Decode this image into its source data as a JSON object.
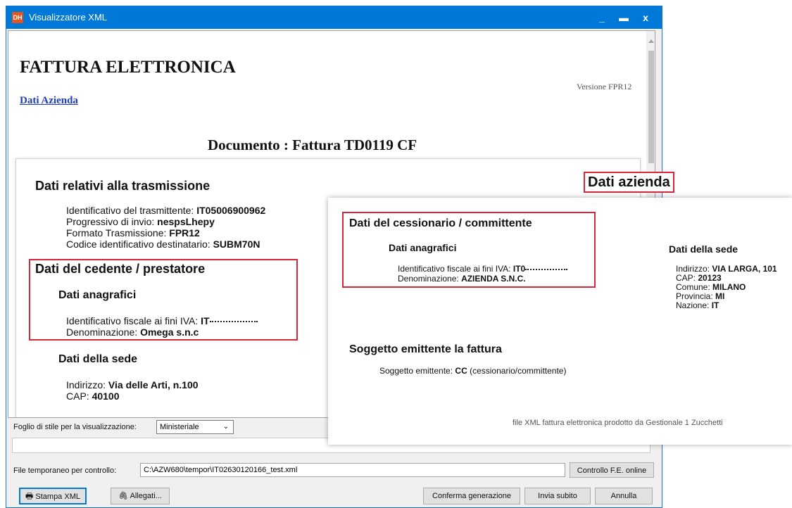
{
  "window": {
    "icon_text": "DH",
    "title": "Visualizzatore XML",
    "controls": [
      "_",
      "▬",
      "x"
    ]
  },
  "invoice": {
    "heading": "FATTURA ELETTRONICA",
    "company_link": "Dati Azienda",
    "version": "Versione FPR12",
    "document_title": "Documento : Fattura TD0119 CF",
    "trasmissione": {
      "title": "Dati relativi alla trasmissione",
      "rows": [
        {
          "label": "Identificativo del trasmittente: ",
          "value": "IT05006900962"
        },
        {
          "label": "Progressivo di invio: ",
          "value": "nespsLhepy"
        },
        {
          "label": "Formato Trasmissione: ",
          "value": "FPR12"
        },
        {
          "label": "Codice identificativo destinatario: ",
          "value": "SUBM70N"
        }
      ]
    },
    "cedente": {
      "title": "Dati del cedente / prestatore",
      "anagrafici_title": "Dati anagrafici",
      "iva_label": "Identificativo fiscale ai fini IVA: ",
      "iva_value": "IT",
      "denominazione_label": "Denominazione: ",
      "denominazione_value": "Omega s.n.c",
      "sede_title": "Dati della sede",
      "indirizzo_label": "Indirizzo: ",
      "indirizzo_value": "Via delle Arti, n.100",
      "cap_label": "CAP: ",
      "cap_value": "40100"
    }
  },
  "overlay": {
    "header": "Dati azienda",
    "cessionario": {
      "title": "Dati del cessionario / committente",
      "anagrafici_title": "Dati anagrafici",
      "iva_label": "Identificativo fiscale ai fini IVA: ",
      "iva_value": "IT0",
      "denominazione_label": "Denominazione: ",
      "denominazione_value": "AZIENDA S.N.C."
    },
    "sede": {
      "title": "Dati della sede",
      "rows": [
        {
          "label": "Indirizzo: ",
          "value": "VIA LARGA, 101"
        },
        {
          "label": "CAP: ",
          "value": "20123"
        },
        {
          "label": "Comune: ",
          "value": "MILANO"
        },
        {
          "label": "Provincia: ",
          "value": "MI"
        },
        {
          "label": "Nazione: ",
          "value": "IT"
        }
      ]
    },
    "emittente": {
      "title": "Soggetto emittente la fattura",
      "label": "Soggetto emittente: ",
      "value": "CC",
      "suffix": " (cessionario/committente)"
    },
    "footer": "file XML fattura elettronica prodotto da Gestionale 1 Zucchetti"
  },
  "bottom": {
    "stylesheet_label": "Foglio di stile per la visualizzazione:",
    "stylesheet_value": "Ministeriale",
    "tempfile_label": "File temporaneo per controllo:",
    "tempfile_value": "C:\\AZW680\\tempor\\IT02630120166_test.xml",
    "online_check": "Controllo F.E. online",
    "print_xml": "Stampa XML",
    "attachments": "Allegati...",
    "confirm": "Conferma generazione",
    "send_now": "Invia subito",
    "cancel": "Annulla"
  }
}
